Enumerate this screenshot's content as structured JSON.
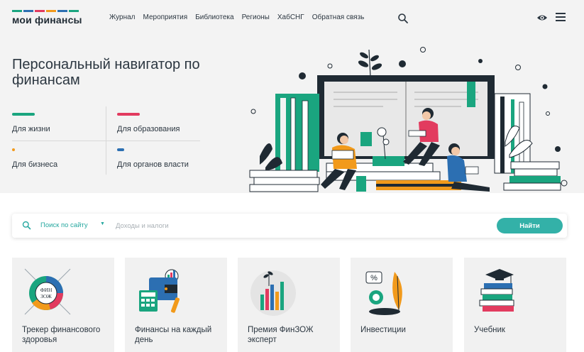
{
  "header": {
    "logo_text": "мои финансы",
    "logo_colors": [
      "#1aa57f",
      "#2c6fb2",
      "#e23b5f",
      "#f29a1b"
    ],
    "nav": [
      "Журнал",
      "Мероприятия",
      "Библиотека",
      "Регионы",
      "ХабСНГ",
      "Обратная связь"
    ],
    "icons": [
      "search-icon",
      "eye-icon",
      "menu-icon"
    ]
  },
  "hero": {
    "title": "Персональный навигатор по финансам",
    "categories": [
      {
        "label": "Для жизни",
        "color": "#1aa57f"
      },
      {
        "label": "Для образования",
        "color": "#e23b5f"
      },
      {
        "label": "Для бизнеса",
        "color": "#f29a1b"
      },
      {
        "label": "Для органов власти",
        "color": "#2c6fb2"
      }
    ]
  },
  "search": {
    "scope": "Поиск по сайту",
    "placeholder": "Доходы и налоги",
    "button": "Найти",
    "accent": "#33b1a8"
  },
  "cards": [
    {
      "title": "Трекер финансового здоровья",
      "icon": "fin-zozh-tracker-icon"
    },
    {
      "title": "Финансы на каждый день",
      "icon": "calculator-wallet-icon"
    },
    {
      "title": "Премия ФинЗОЖ эксперт",
      "icon": "bar-plant-icon"
    },
    {
      "title": "Инвестиции",
      "icon": "investment-leaf-icon"
    },
    {
      "title": "Учебник",
      "icon": "books-graduation-icon"
    }
  ]
}
